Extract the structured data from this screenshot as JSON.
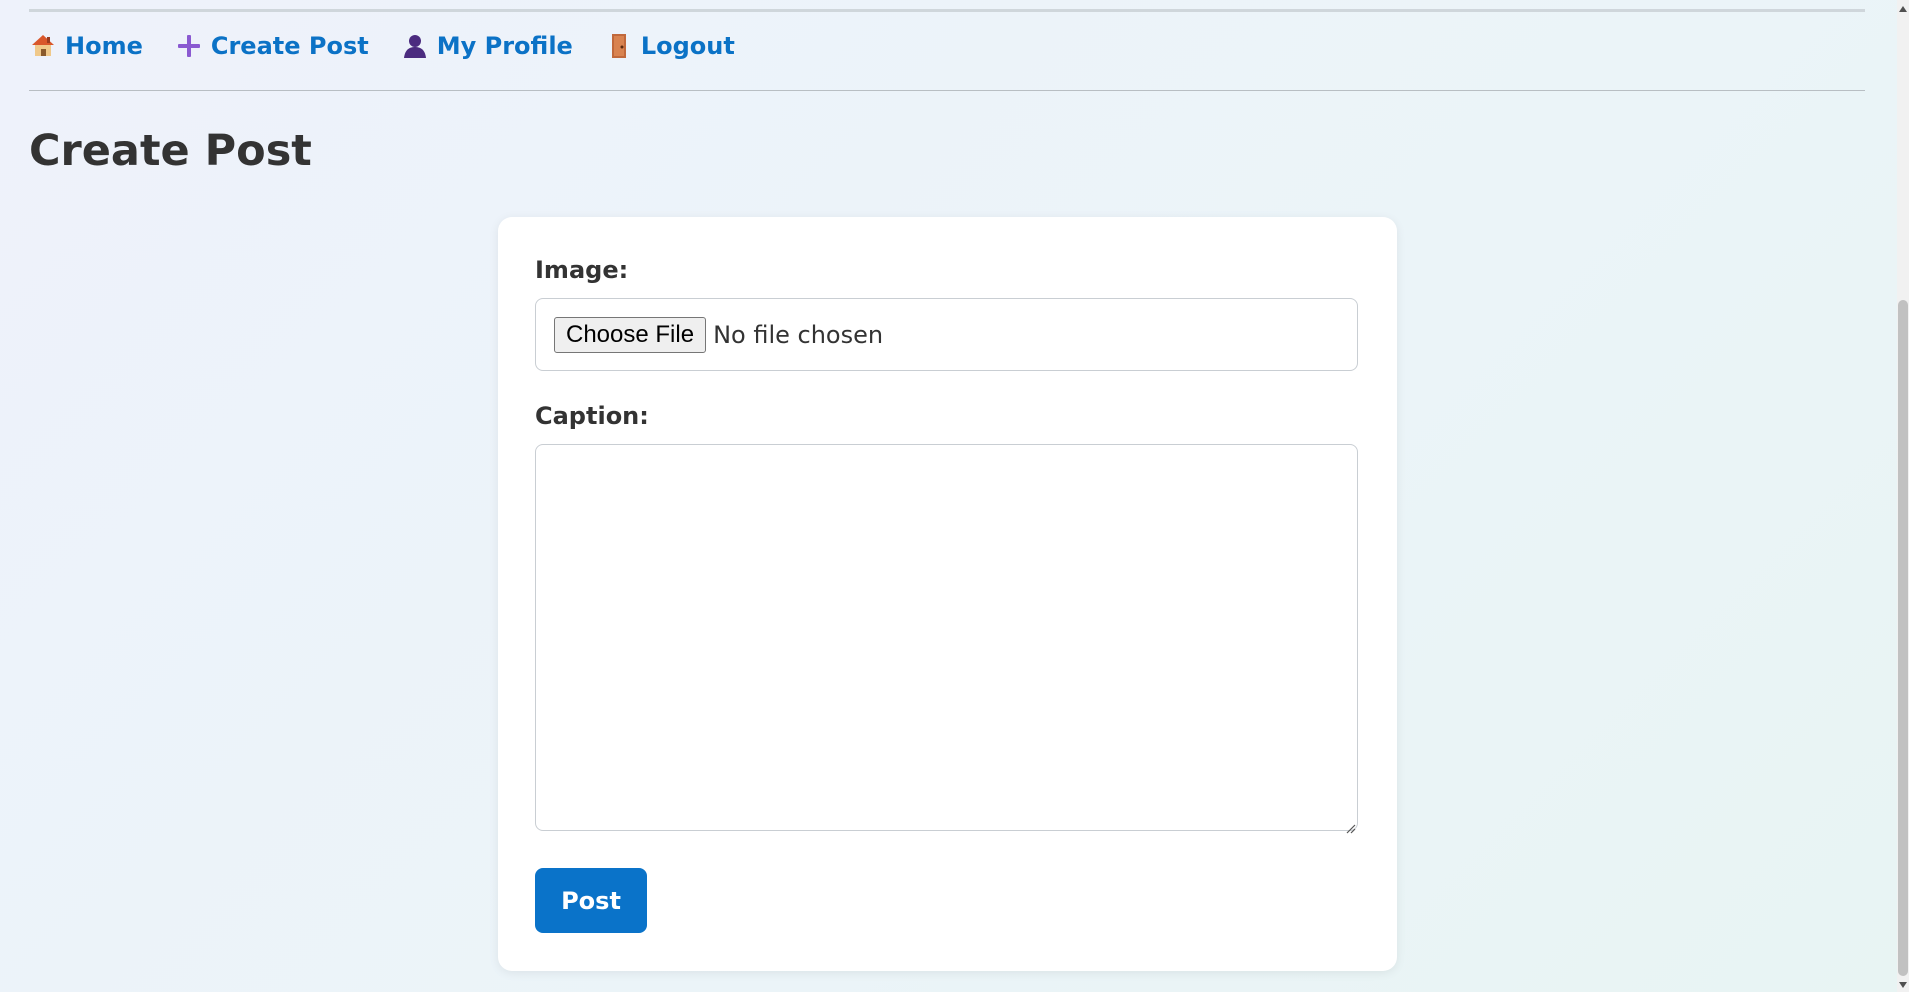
{
  "nav": {
    "items": [
      {
        "label": "Home",
        "icon": "house-icon"
      },
      {
        "label": "Create Post",
        "icon": "plus-icon"
      },
      {
        "label": "My Profile",
        "icon": "user-silhouette-icon"
      },
      {
        "label": "Logout",
        "icon": "door-icon"
      }
    ]
  },
  "page": {
    "title": "Create Post"
  },
  "form": {
    "image_label": "Image:",
    "file_button_label": "Choose File",
    "file_status": "No file chosen",
    "caption_label": "Caption:",
    "caption_value": "",
    "submit_label": "Post"
  },
  "colors": {
    "accent": "#0a73c9",
    "nav_link": "#0b72c6",
    "text": "#333333",
    "card_bg": "#ffffff"
  }
}
